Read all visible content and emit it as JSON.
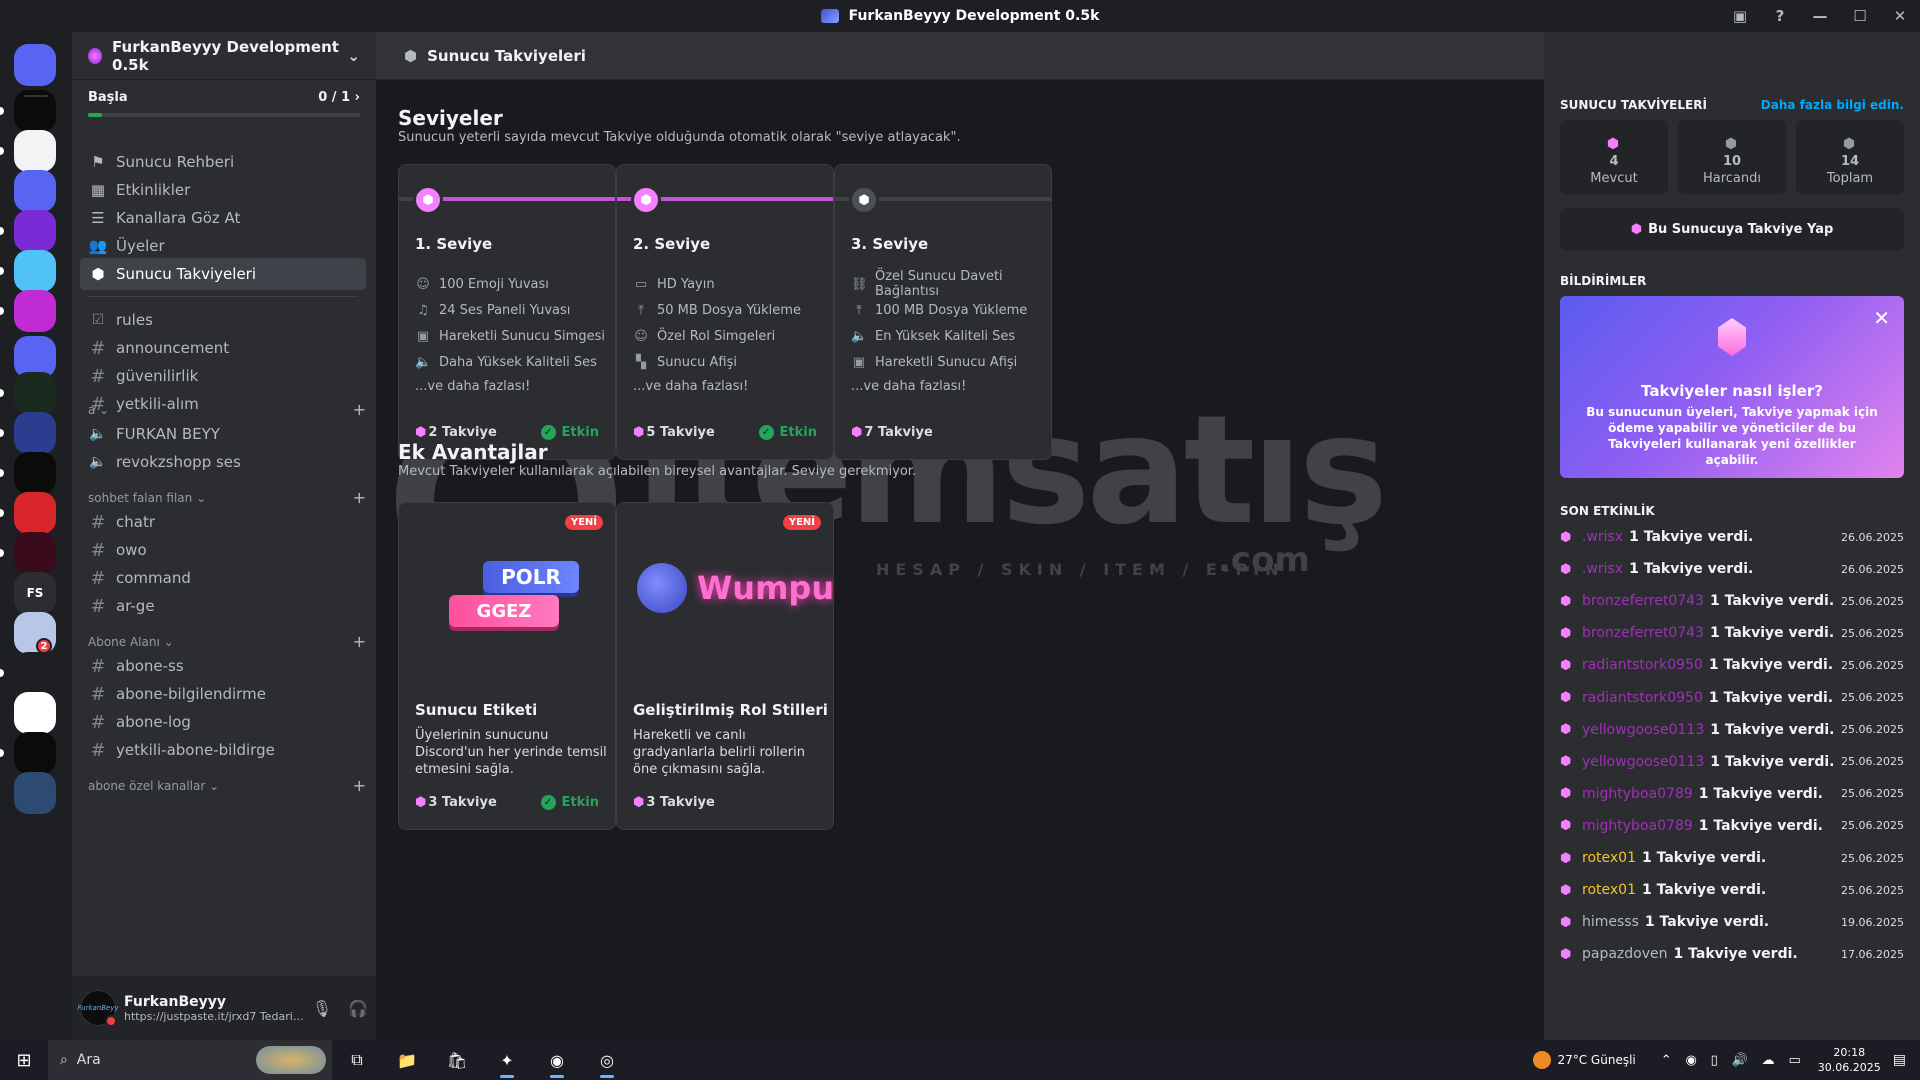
{
  "window": {
    "title": "FurkanBeyyy Development 0.5k"
  },
  "titlebar_icons": [
    "inbox-icon",
    "help-icon",
    "minimize-icon",
    "maximize-icon",
    "close-icon"
  ],
  "guilds": [
    {
      "label": "",
      "color": "#5865f2"
    },
    {
      "label": "",
      "color": "#0b0b0b"
    },
    {
      "label": "",
      "color": "#f2f3f5"
    },
    {
      "label": "",
      "color": "#5865f2"
    },
    {
      "label": "",
      "color": "#7a2bd6"
    },
    {
      "label": "",
      "color": "#4fc3f7"
    },
    {
      "label": "",
      "color": "#c02bd6"
    },
    {
      "label": "",
      "color": "#5865f2"
    },
    {
      "label": "",
      "color": "#1b2a1e"
    },
    {
      "label": "",
      "color": "#2a3d8f"
    },
    {
      "label": "",
      "color": "#0b0b0b"
    },
    {
      "label": "",
      "color": "#d8262b"
    },
    {
      "label": "",
      "color": "#3a0b1a"
    },
    {
      "label": "FS",
      "color": "#2b2d31"
    },
    {
      "label": "",
      "color": "#b8c7e8",
      "badge": "2"
    },
    {
      "label": "",
      "color": "#1e1f22"
    },
    {
      "label": "",
      "color": "#ffffff"
    },
    {
      "label": "",
      "color": "#0b0b0b"
    },
    {
      "label": "",
      "color": "#2c4a72"
    }
  ],
  "server": {
    "name": "FurkanBeyyy Development 0.5k",
    "basla": {
      "label": "Başla",
      "progress_text": "0 / 1",
      "progress": 0.05
    }
  },
  "nav": [
    {
      "label": "Sunucu Rehberi",
      "icon": "signpost-icon"
    },
    {
      "label": "Etkinlikler",
      "icon": "calendar-icon"
    },
    {
      "label": "Kanallara Göz At",
      "icon": "browse-channels-icon"
    },
    {
      "label": "Üyeler",
      "icon": "members-icon"
    },
    {
      "label": "Sunucu Takviyeleri",
      "icon": "boost-icon",
      "active": true
    }
  ],
  "channels": {
    "top": [
      "rules",
      "announcement",
      "güvenilirlik",
      "yetkili-alım"
    ],
    "cat_a": {
      "name": "a",
      "items": [
        "FURKAN BEYY",
        "revokzshopp ses"
      ]
    },
    "cat_sohbet": {
      "name": "sohbet falan filan",
      "items": [
        "chatr",
        "owo",
        "command",
        "ar-ge"
      ]
    },
    "cat_abone": {
      "name": "Abone Alanı",
      "items": [
        "abone-ss",
        "abone-bilgilendirme",
        "abone-log",
        "yetkili-abone-bildirge"
      ]
    },
    "cat_ozel": {
      "name": "abone özel kanallar"
    }
  },
  "user": {
    "name": "FurkanBeyyy",
    "status": "https://justpaste.it/jrxd7 Tedarik ...",
    "avatar_text": "FurkanBeyy"
  },
  "main": {
    "header": "Sunucu Takviyeleri",
    "levels_title": "Seviyeler",
    "levels_sub": "Sunucun yeterli sayıda mevcut Takviye olduğunda otomatik olarak \"seviye atlayacak\".",
    "tiers": [
      {
        "title": "1. Seviye",
        "perks": [
          "100 Emoji Yuvası",
          "24 Ses Paneli Yuvası",
          "Hareketli Sunucu Simgesi",
          "Daha Yüksek Kaliteli Ses"
        ],
        "more": "...ve daha fazlası!",
        "cost": "2 Takviye",
        "active": "Etkin",
        "fill": 1.0
      },
      {
        "title": "2. Seviye",
        "perks": [
          "HD Yayın",
          "50 MB Dosya Yükleme",
          "Özel Rol Simgeleri",
          "Sunucu Afişi"
        ],
        "more": "...ve daha fazlası!",
        "cost": "5 Takviye",
        "active": "Etkin",
        "fill": 1.0
      },
      {
        "title": "3. Seviye",
        "perks": [
          "Özel Sunucu Daveti Bağlantısı",
          "100 MB Dosya Yükleme",
          "En Yüksek Kaliteli Ses",
          "Hareketli Sunucu Afişi"
        ],
        "more": "...ve daha fazlası!",
        "cost": "7 Takviye",
        "active": "",
        "fill": 0.0
      }
    ],
    "extras_title": "Ek Avantajlar",
    "extras_sub": "Mevcut Takviyeler kullanılarak açılabilen bireysel avantajlar. Seviye gerekmiyor.",
    "extras": [
      {
        "title": "Sunucu Etiketi",
        "desc": "Üyelerinin sunucunu Discord'un her yerinde temsil etmesini sağla.",
        "cost": "3 Takviye",
        "active": "Etkin",
        "badge": "YENİ",
        "art1": "POLR",
        "art2": "GGEZ"
      },
      {
        "title": "Geliştirilmiş Rol Stilleri",
        "desc": "Hareketli ve canlı gradyanlarla belirli rollerin öne çıkmasını sağla.",
        "cost": "3 Takviye",
        "active": "",
        "badge": "YENİ",
        "art1": "Wumpus"
      }
    ],
    "watermark": {
      "word": "itemsatış",
      "tagline": "HESAP / SKIN / ITEM / E-PIN",
      "domain": ".com"
    }
  },
  "right": {
    "title": "SUNUCU TAKVİYELERİ",
    "link": "Daha fazla bilgi edin.",
    "stats": [
      {
        "value": "4",
        "label": "Mevcut",
        "pink": true
      },
      {
        "value": "10",
        "label": "Harcandı",
        "pink": false
      },
      {
        "value": "14",
        "label": "Toplam",
        "pink": false
      }
    ],
    "boost_button": "Bu Sunucuya Takviye Yap",
    "notif_title": "BİLDİRİMLER",
    "notif": {
      "heading": "Takviyeler nasıl işler?",
      "body": "Bu sunucunun üyeleri, Takviye yapmak için ödeme yapabilir ve yöneticiler de bu Takviyeleri kullanarak yeni özellikler açabilir."
    },
    "activity_title": "SON ETKİNLİK",
    "activity": [
      {
        "user": ".wrisx",
        "action": "1 Takviye verdi.",
        "date": "26.06.2025",
        "color": "#a12fb8"
      },
      {
        "user": ".wrisx",
        "action": "1 Takviye verdi.",
        "date": "26.06.2025",
        "color": "#a12fb8"
      },
      {
        "user": "bronzeferret0743",
        "action": "1 Takviye verdi.",
        "date": "25.06.2025",
        "color": "#a12fb8"
      },
      {
        "user": "bronzeferret0743",
        "action": "1 Takviye verdi.",
        "date": "25.06.2025",
        "color": "#a12fb8"
      },
      {
        "user": "radiantstork0950",
        "action": "1 Takviye verdi.",
        "date": "25.06.2025",
        "color": "#a12fb8"
      },
      {
        "user": "radiantstork0950",
        "action": "1 Takviye verdi.",
        "date": "25.06.2025",
        "color": "#a12fb8"
      },
      {
        "user": "yellowgoose0113",
        "action": "1 Takviye verdi.",
        "date": "25.06.2025",
        "color": "#a12fb8"
      },
      {
        "user": "yellowgoose0113",
        "action": "1 Takviye verdi.",
        "date": "25.06.2025",
        "color": "#a12fb8"
      },
      {
        "user": "mightyboa0789",
        "action": "1 Takviye verdi.",
        "date": "25.06.2025",
        "color": "#a12fb8"
      },
      {
        "user": "mightyboa0789",
        "action": "1 Takviye verdi.",
        "date": "25.06.2025",
        "color": "#a12fb8"
      },
      {
        "user": "rotex01",
        "action": "1 Takviye verdi.",
        "date": "25.06.2025",
        "color": "#f0c330"
      },
      {
        "user": "rotex01",
        "action": "1 Takviye verdi.",
        "date": "25.06.2025",
        "color": "#f0c330"
      },
      {
        "user": "himesss",
        "action": "1 Takviye verdi.",
        "date": "19.06.2025",
        "color": "#b5bac1"
      },
      {
        "user": "papazdoven",
        "action": "1 Takviye verdi.",
        "date": "17.06.2025",
        "color": "#b5bac1"
      }
    ]
  },
  "taskbar": {
    "search": "Ara",
    "weather": "27°C  Güneşli",
    "time": "20:18",
    "date": "30.06.2025"
  }
}
